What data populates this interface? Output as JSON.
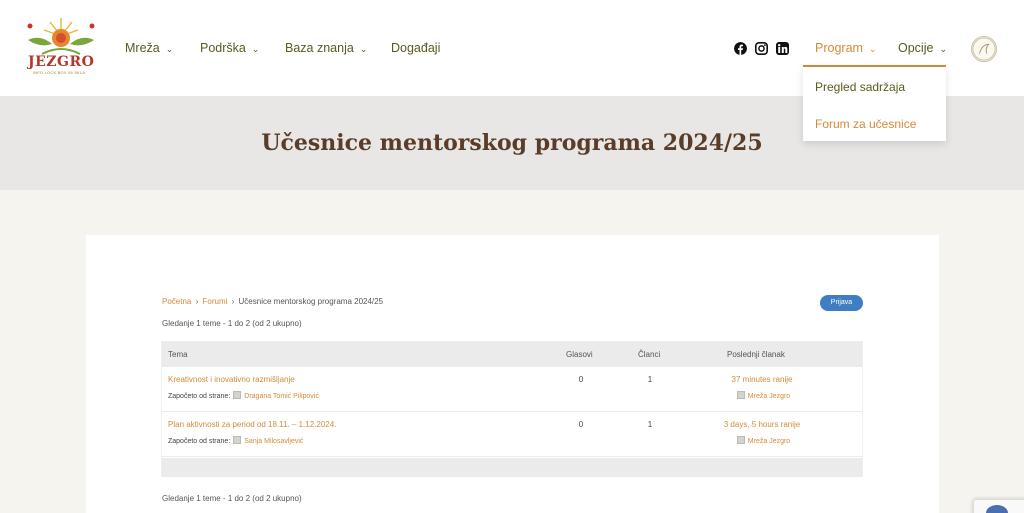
{
  "logo": {
    "name": "JEZGRO",
    "tagline": "INFO LOCK BOX 06 SKLA"
  },
  "nav": {
    "items": [
      {
        "label": "Mreža",
        "has_dropdown": true
      },
      {
        "label": "Podrška",
        "has_dropdown": true
      },
      {
        "label": "Baza znanja",
        "has_dropdown": true
      },
      {
        "label": "Događaji",
        "has_dropdown": false
      }
    ],
    "social": [
      "facebook-icon",
      "instagram-icon",
      "linkedin-icon"
    ],
    "program": {
      "label": "Program",
      "active": true
    },
    "options": {
      "label": "Opcije"
    },
    "chevron": "⌄"
  },
  "dropdown": {
    "items": [
      {
        "label": "Pregled sadržaja"
      },
      {
        "label": "Forum za učesnice"
      }
    ]
  },
  "page": {
    "title": "Učesnice mentorskog programa 2024/25"
  },
  "breadcrumb": {
    "home": "Početna",
    "forums": "Forumi",
    "current": "Učesnice mentorskog programa 2024/25",
    "separator": "›"
  },
  "login_button": "Prijava",
  "viewing_text": "Gledanje 1 teme - 1 do 2 (od 2 ukupno)",
  "table": {
    "headers": {
      "topic": "Tema",
      "voices": "Glasovi",
      "posts": "Članci",
      "last_post": "Poslednji članak"
    },
    "started_by_label": "Započeto od strane:",
    "rows": [
      {
        "title": "Kreativnost i inovativno razmišljanje",
        "author": "Dragana Tomić Pilipović",
        "voices": "0",
        "posts": "1",
        "last_time": "37 minutes ranije",
        "last_author": "Mreža Jezgro"
      },
      {
        "title": "Plan aktivnosti za period od 18.11. – 1.12.2024.",
        "author": "Sanja Milosavljević",
        "voices": "0",
        "posts": "1",
        "last_time": "3 days, 5 hours ranije",
        "last_author": "Mreža Jezgro"
      }
    ]
  },
  "colors": {
    "accent": "#d48a3a",
    "nav_text": "#5a5a1f",
    "title": "#5a3c28",
    "button": "#3f7ec2",
    "title_band": "#e8e7e5",
    "page_bg": "#f6f4ee"
  }
}
